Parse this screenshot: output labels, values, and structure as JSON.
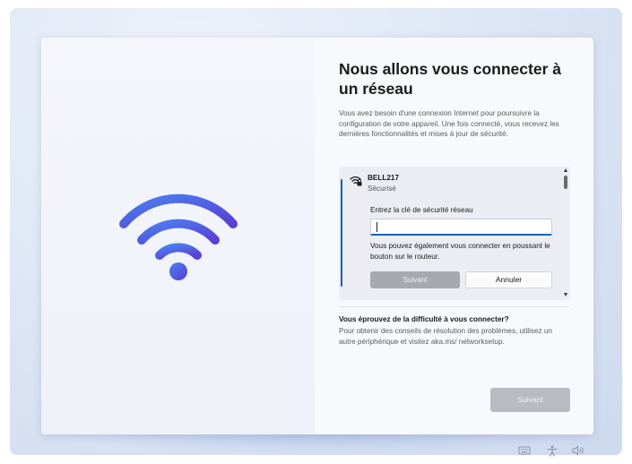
{
  "oobe": {
    "title": "Nous allons vous connecter à un réseau",
    "description": "Vous avez besoin d'une connexion Internet pour poursuivre la configuration de votre appareil. Une fois connecté, vous recevez les dernières fonctionnalités et mises à jour de sécurité.",
    "network": {
      "name": "BELL217",
      "status": "Sécurisé",
      "key_label": "Entrez la clé de sécurité réseau",
      "key_value": "",
      "router_hint": "Vous pouvez également vous connecter en poussant le bouton sur le routeur.",
      "next_label": "Suivant",
      "cancel_label": "Annuler"
    },
    "help": {
      "title": "Vous éprouvez de la difficulté à vous connecter?",
      "text": "Pour obtenir des conseils de résolution des problèmes, utilisez un autre périphérique et visitez aka.ms/ networksetup."
    },
    "next_button": "Suivant"
  },
  "icons": {
    "illustration": "wifi-icon",
    "network": "wifi-secured-icon",
    "tray": [
      "keyboard-icon",
      "accessibility-icon",
      "volume-icon"
    ]
  },
  "colors": {
    "accent": "#1a5fb4",
    "wifi_gradient_start": "#3f6fe0",
    "wifi_gradient_end": "#5b3fd6",
    "disabled_button": "#b9bbc0"
  }
}
